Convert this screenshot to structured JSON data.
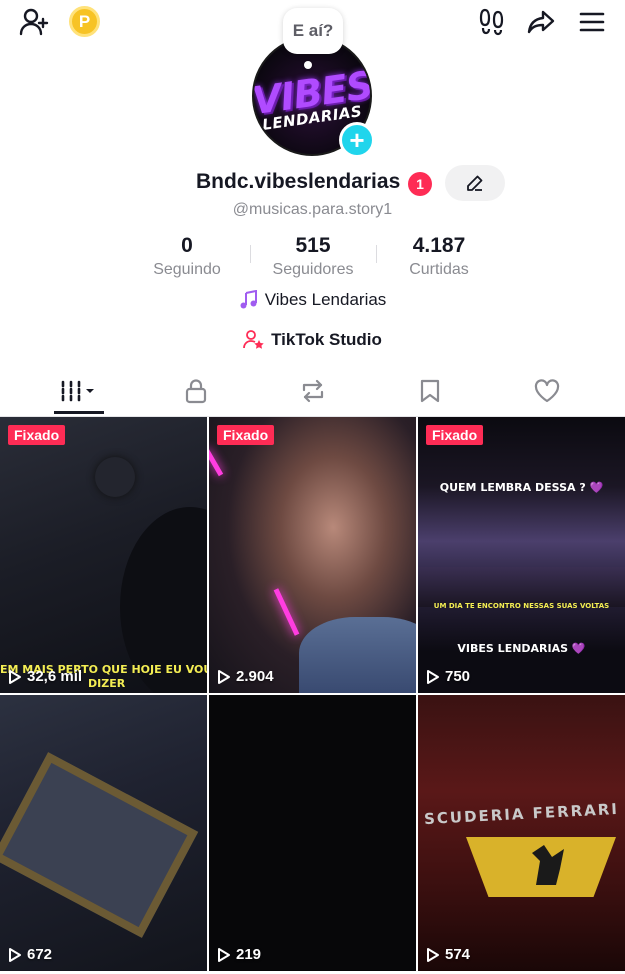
{
  "header": {
    "speech_bubble": "E aí?",
    "logo_line1": "VIBES",
    "logo_line2": "LENDARIAS",
    "icons": [
      "add-friend-icon",
      "coin-icon",
      "footprints-icon",
      "share-icon",
      "menu-icon"
    ],
    "coin_letter": "P"
  },
  "profile": {
    "username": "Bndc.vibeslendarias",
    "notification_count": "1",
    "handle": "@musicas.para.story1",
    "bio_icon": "music-note-icon",
    "bio": "Vibes Lendarias",
    "studio_icon": "creator-icon",
    "studio_label": "TikTok Studio"
  },
  "stats": [
    {
      "value": "0",
      "label": "Seguindo"
    },
    {
      "value": "515",
      "label": "Seguidores"
    },
    {
      "value": "4.187",
      "label": "Curtidas"
    }
  ],
  "tabs": [
    {
      "name": "videos",
      "icon": "grid-icon",
      "active": true
    },
    {
      "name": "private",
      "icon": "lock-icon",
      "active": false
    },
    {
      "name": "reposts",
      "icon": "repost-icon",
      "active": false
    },
    {
      "name": "saved",
      "icon": "bookmark-icon",
      "active": false
    },
    {
      "name": "liked",
      "icon": "heart-icon",
      "active": false
    }
  ],
  "videos": [
    {
      "pinned": "Fixado",
      "views": "32,6 mil",
      "caption": "EM MAIS PERTO QUE HOJE EU VOU T",
      "caption2": "DIZER"
    },
    {
      "pinned": "Fixado",
      "views": "2.904"
    },
    {
      "pinned": "Fixado",
      "views": "750",
      "caption_top": "QUEM LEMBRA DESSA ? 💜",
      "caption_mid": "UM DIA TE ENCONTRO NESSAS SUAS VOLTAS",
      "caption_bot": "VIBES LENDARIAS 💜"
    },
    {
      "views": "672"
    },
    {
      "views": "219"
    },
    {
      "views": "574",
      "caption_top": "SCUDERIA FERRARI"
    }
  ],
  "colors": {
    "accent": "#fe2c55",
    "badge_blue": "#20d5ec",
    "text_primary": "#161823",
    "text_secondary": "#8a8b91"
  }
}
